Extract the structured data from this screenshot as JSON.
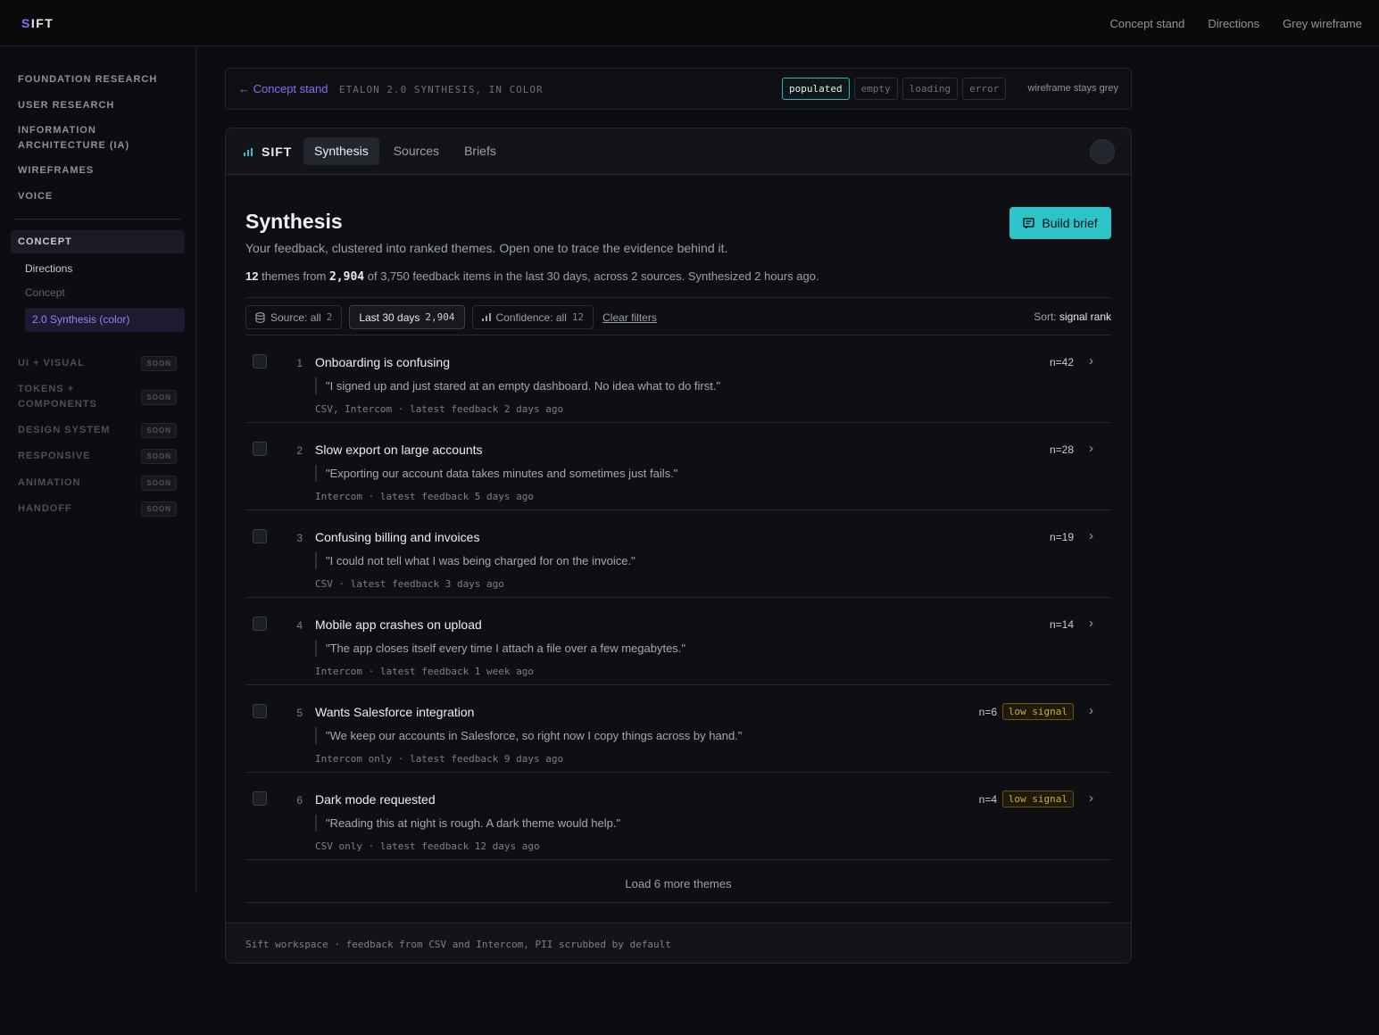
{
  "topbar": {
    "logo_s": "S",
    "logo_rest": "IFT",
    "nav": [
      "Concept stand",
      "Directions",
      "Grey wireframe"
    ]
  },
  "sidebar": {
    "sections": [
      "FOUNDATION RESEARCH",
      "USER RESEARCH",
      "INFORMATION ARCHITECTURE (IA)",
      "WIREFRAMES",
      "VOICE"
    ],
    "concept": "CONCEPT",
    "sub_items": [
      "Directions",
      "Concept"
    ],
    "active_item": "2.0 Synthesis (color)",
    "soon_items": [
      "UI + VISUAL",
      "TOKENS + COMPONENTS",
      "DESIGN SYSTEM",
      "RESPONSIVE",
      "ANIMATION",
      "HANDOFF"
    ],
    "soon_label": "SOON"
  },
  "stand": {
    "back": "← Concept stand",
    "title": "ETALON 2.0 SYNTHESIS, IN COLOR",
    "states": [
      "populated",
      "empty",
      "loading",
      "error"
    ],
    "active_state": "populated",
    "note": "wireframe stays grey"
  },
  "app": {
    "logo": "SIFT",
    "tabs": [
      "Synthesis",
      "Sources",
      "Briefs"
    ],
    "active_tab": "Synthesis",
    "title": "Synthesis",
    "subtitle": "Your feedback, clustered into ranked themes. Open one to trace the evidence behind it.",
    "summary": {
      "themes": "12",
      "themes_text": "themes from",
      "items": "2,904",
      "rest": "of 3,750 feedback items in the last 30 days, across 2 sources. Synthesized 2 hours ago."
    },
    "build_label": "Build brief",
    "filters": {
      "source_label": "Source: all",
      "source_count": "2",
      "period_label": "Last 30 days",
      "period_count": "2,904",
      "confidence_label": "Confidence: all",
      "confidence_count": "12",
      "clear": "Clear filters",
      "sort_label": "Sort:",
      "sort_value": "signal rank"
    },
    "themes": [
      {
        "rank": "1",
        "title": "Onboarding is confusing",
        "quote": "\"I signed up and just stared at an empty dashboard. No idea what to do first.\"",
        "meta": "CSV, Intercom · latest feedback 2 days ago",
        "count": "n=42",
        "low": ""
      },
      {
        "rank": "2",
        "title": "Slow export on large accounts",
        "quote": "\"Exporting our account data takes minutes and sometimes just fails.\"",
        "meta": "Intercom · latest feedback 5 days ago",
        "count": "n=28",
        "low": ""
      },
      {
        "rank": "3",
        "title": "Confusing billing and invoices",
        "quote": "\"I could not tell what I was being charged for on the invoice.\"",
        "meta": "CSV · latest feedback 3 days ago",
        "count": "n=19",
        "low": ""
      },
      {
        "rank": "4",
        "title": "Mobile app crashes on upload",
        "quote": "\"The app closes itself every time I attach a file over a few megabytes.\"",
        "meta": "Intercom · latest feedback 1 week ago",
        "count": "n=14",
        "low": ""
      },
      {
        "rank": "5",
        "title": "Wants Salesforce integration",
        "quote": "\"We keep our accounts in Salesforce, so right now I copy things across by hand.\"",
        "meta": "Intercom only · latest feedback 9 days ago",
        "count": "n=6",
        "low": "low signal"
      },
      {
        "rank": "6",
        "title": "Dark mode requested",
        "quote": "\"Reading this at night is rough. A dark theme would help.\"",
        "meta": "CSV only · latest feedback 12 days ago",
        "count": "n=4",
        "low": "low signal"
      }
    ],
    "load_more": "Load 6 more themes",
    "footer": "Sift workspace · feedback from CSV and Intercom, PII scrubbed by default"
  },
  "colors": {
    "accent_purple": "#8b6cf6",
    "accent_teal": "#2cc3c9",
    "low_signal": "#d7a83c"
  }
}
